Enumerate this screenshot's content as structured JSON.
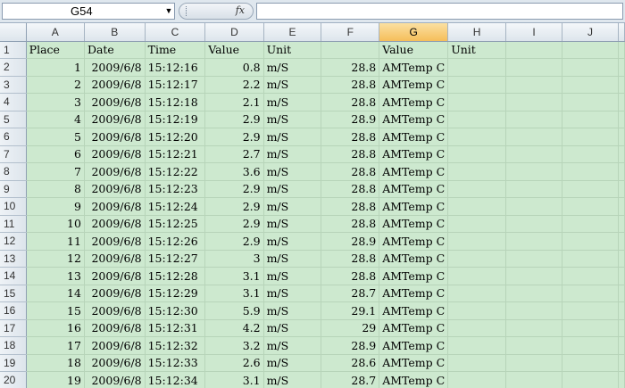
{
  "formula_bar": {
    "name_box": "G54",
    "fx_label": "fx",
    "formula": ""
  },
  "columns": [
    "A",
    "B",
    "C",
    "D",
    "E",
    "F",
    "G",
    "H",
    "I",
    "J"
  ],
  "selected_column": "G",
  "header_row": [
    "Place",
    "Date",
    "Time",
    "Value",
    "Unit",
    "",
    "Value",
    "Unit",
    "",
    "",
    ""
  ],
  "rows": [
    [
      "1",
      "2009/6/8",
      "15:12:16",
      "0.8",
      "m/S",
      "28.8",
      "AMTemp C"
    ],
    [
      "2",
      "2009/6/8",
      "15:12:17",
      "2.2",
      "m/S",
      "28.8",
      "AMTemp C"
    ],
    [
      "3",
      "2009/6/8",
      "15:12:18",
      "2.1",
      "m/S",
      "28.8",
      "AMTemp C"
    ],
    [
      "4",
      "2009/6/8",
      "15:12:19",
      "2.9",
      "m/S",
      "28.9",
      "AMTemp C"
    ],
    [
      "5",
      "2009/6/8",
      "15:12:20",
      "2.9",
      "m/S",
      "28.8",
      "AMTemp C"
    ],
    [
      "6",
      "2009/6/8",
      "15:12:21",
      "2.7",
      "m/S",
      "28.8",
      "AMTemp C"
    ],
    [
      "7",
      "2009/6/8",
      "15:12:22",
      "3.6",
      "m/S",
      "28.8",
      "AMTemp C"
    ],
    [
      "8",
      "2009/6/8",
      "15:12:23",
      "2.9",
      "m/S",
      "28.8",
      "AMTemp C"
    ],
    [
      "9",
      "2009/6/8",
      "15:12:24",
      "2.9",
      "m/S",
      "28.8",
      "AMTemp C"
    ],
    [
      "10",
      "2009/6/8",
      "15:12:25",
      "2.9",
      "m/S",
      "28.8",
      "AMTemp C"
    ],
    [
      "11",
      "2009/6/8",
      "15:12:26",
      "2.9",
      "m/S",
      "28.9",
      "AMTemp C"
    ],
    [
      "12",
      "2009/6/8",
      "15:12:27",
      "3",
      "m/S",
      "28.8",
      "AMTemp C"
    ],
    [
      "13",
      "2009/6/8",
      "15:12:28",
      "3.1",
      "m/S",
      "28.8",
      "AMTemp C"
    ],
    [
      "14",
      "2009/6/8",
      "15:12:29",
      "3.1",
      "m/S",
      "28.7",
      "AMTemp C"
    ],
    [
      "15",
      "2009/6/8",
      "15:12:30",
      "5.9",
      "m/S",
      "29.1",
      "AMTemp C"
    ],
    [
      "16",
      "2009/6/8",
      "15:12:31",
      "4.2",
      "m/S",
      "29",
      "AMTemp C"
    ],
    [
      "17",
      "2009/6/8",
      "15:12:32",
      "3.2",
      "m/S",
      "28.9",
      "AMTemp C"
    ],
    [
      "18",
      "2009/6/8",
      "15:12:33",
      "2.6",
      "m/S",
      "28.6",
      "AMTemp C"
    ],
    [
      "19",
      "2009/6/8",
      "15:12:34",
      "3.1",
      "m/S",
      "28.7",
      "AMTemp C"
    ]
  ],
  "colors": {
    "cell_background": "#cde9cf",
    "selected_header": "#f5be5a",
    "gridline": "#b7d4b9"
  }
}
